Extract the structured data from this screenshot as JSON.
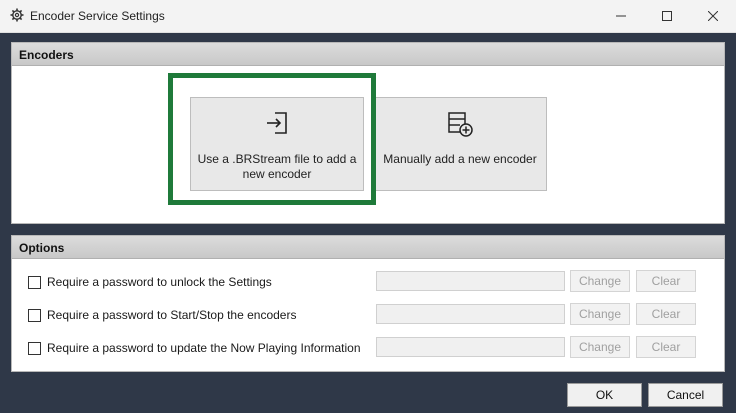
{
  "window": {
    "title": "Encoder Service Settings",
    "icons": {
      "app": "gear-icon",
      "minimize": "minimize-icon",
      "maximize": "maximize-icon",
      "close": "close-icon"
    }
  },
  "encoders": {
    "header": "Encoders",
    "file_button": {
      "label": "Use a .BRStream file to add a new encoder",
      "icon": "file-import-icon"
    },
    "manual_button": {
      "label": "Manually add a new encoder",
      "icon": "table-add-icon"
    },
    "highlight_color": "#1f7a3a"
  },
  "options": {
    "header": "Options",
    "rows": [
      {
        "label": "Require a password to unlock the Settings",
        "checked": false,
        "password": "",
        "change": "Change",
        "clear": "Clear"
      },
      {
        "label": "Require a password to Start/Stop the encoders",
        "checked": false,
        "password": "",
        "change": "Change",
        "clear": "Clear"
      },
      {
        "label": "Require a password to update the Now Playing Information",
        "checked": false,
        "password": "",
        "change": "Change",
        "clear": "Clear"
      }
    ]
  },
  "footer": {
    "ok": "OK",
    "cancel": "Cancel"
  }
}
